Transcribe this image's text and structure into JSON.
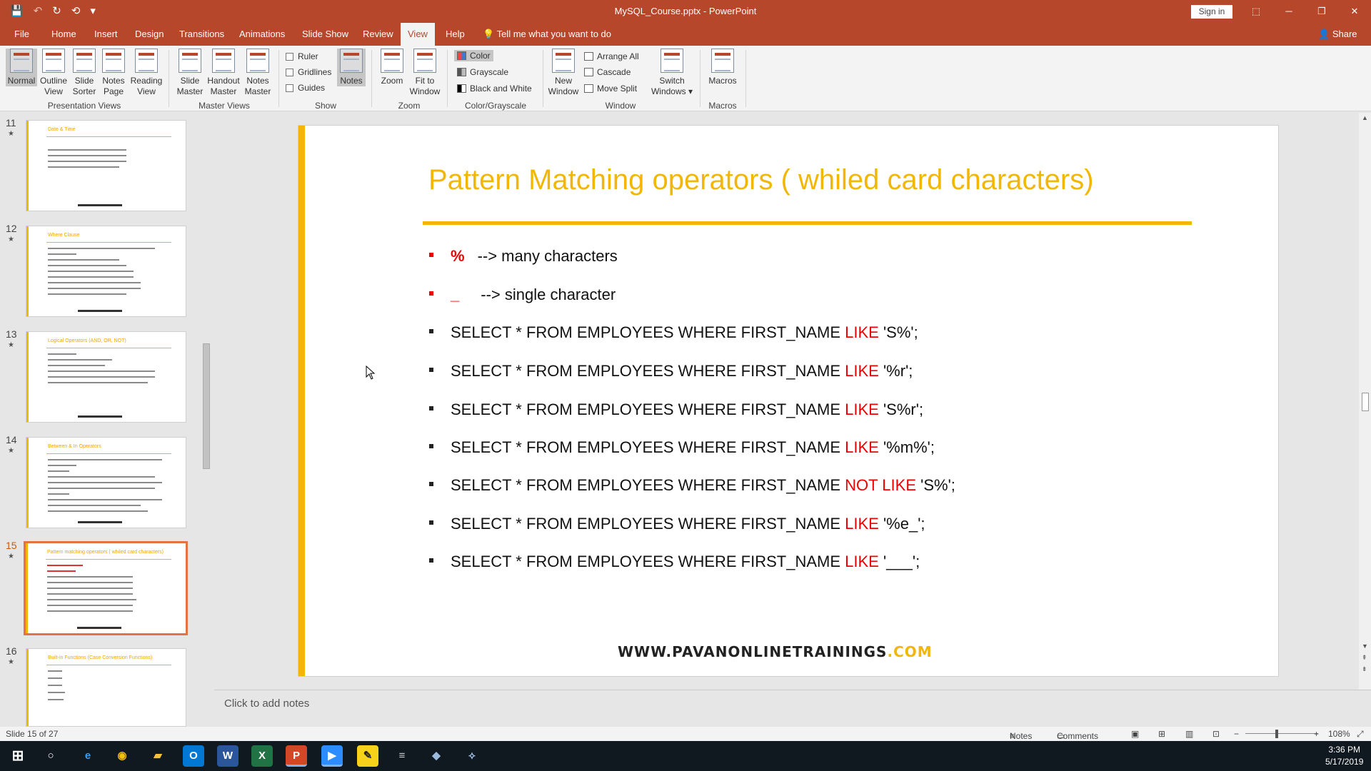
{
  "window": {
    "title": "MySQL_Course.pptx - PowerPoint",
    "sign_in": "Sign in",
    "minimize": "─",
    "restore": "❐",
    "close": "✕",
    "ribbon_display": "⬚"
  },
  "quick_access": {
    "save": "💾",
    "undo": "↶",
    "redo": "↻",
    "start": "⟲",
    "customize": "▾"
  },
  "tabs": [
    "File",
    "Home",
    "Insert",
    "Design",
    "Transitions",
    "Animations",
    "Slide Show",
    "Review",
    "View",
    "Help"
  ],
  "active_tab": "View",
  "tell_me": "Tell me what you want to do",
  "share": "Share",
  "ribbon": {
    "presentation_views": {
      "label": "Presentation Views",
      "normal": "Normal",
      "outline": [
        "Outline",
        "View"
      ],
      "sorter": [
        "Slide",
        "Sorter"
      ],
      "notes_page": [
        "Notes",
        "Page"
      ],
      "reading": [
        "Reading",
        "View"
      ]
    },
    "master_views": {
      "label": "Master Views",
      "slide": [
        "Slide",
        "Master"
      ],
      "handout": [
        "Handout",
        "Master"
      ],
      "notes": [
        "Notes",
        "Master"
      ]
    },
    "show": {
      "label": "Show",
      "ruler": "Ruler",
      "gridlines": "Gridlines",
      "guides": "Guides",
      "notes": "Notes"
    },
    "zoom": {
      "label": "Zoom",
      "zoom": "Zoom",
      "fit": [
        "Fit to",
        "Window"
      ]
    },
    "color": {
      "label": "Color/Grayscale",
      "color": "Color",
      "grayscale": "Grayscale",
      "bw": "Black and White"
    },
    "window": {
      "label": "Window",
      "new": [
        "New",
        "Window"
      ],
      "arrange": "Arrange All",
      "cascade": "Cascade",
      "move_split": "Move Split",
      "switch": [
        "Switch",
        "Windows ▾"
      ]
    },
    "macros": {
      "label": "Macros",
      "macros": "Macros"
    }
  },
  "thumbnails": [
    {
      "num": "11",
      "title": "Date & Time"
    },
    {
      "num": "12",
      "title": "Where Clause"
    },
    {
      "num": "13",
      "title": "Logical Operators (AND, OR, NOT)"
    },
    {
      "num": "14",
      "title": "Between & In Operators"
    },
    {
      "num": "15",
      "title": "Pattern matching operators ( whiled card characters)"
    },
    {
      "num": "16",
      "title": "Built-in Functions (Case Conversion Functions)"
    }
  ],
  "slide": {
    "title": "Pattern Matching operators ( whiled card characters)",
    "b1_sym": "%",
    "b1_text": "--> many characters",
    "b2_sym": "_",
    "b2_text": "--> single character",
    "q_prefix": "SELECT * FROM EMPLOYEES WHERE FIRST_NAME",
    "q1_op": "LIKE",
    "q1_val": "'S%';",
    "q2_op": "LIKE",
    "q2_val": "'%r';",
    "q3_op": "LIKE",
    "q3_val": "'S%r';",
    "q4_op": "LIKE",
    "q4_val": "'%m%';",
    "q5_op": "NOT LIKE",
    "q5_val": "'S%';",
    "q6_op": "LIKE",
    "q6_val": "'%e_';",
    "q7_op": "LIKE",
    "q7_val": "'___';",
    "footer_main": "WWW.PAVANONLINETRAININGS",
    "footer_dom": ".COM"
  },
  "notes_placeholder": "Click to add notes",
  "status": {
    "slide": "Slide 15 of 27",
    "notes": "Notes",
    "comments": "Comments",
    "zoom": "108%"
  },
  "clock": {
    "time": "3:36 PM",
    "date": "5/17/2019"
  },
  "colors": {
    "accent": "#b7472a",
    "slide_gold": "#f2b705",
    "keyword_red": "#e00000"
  }
}
